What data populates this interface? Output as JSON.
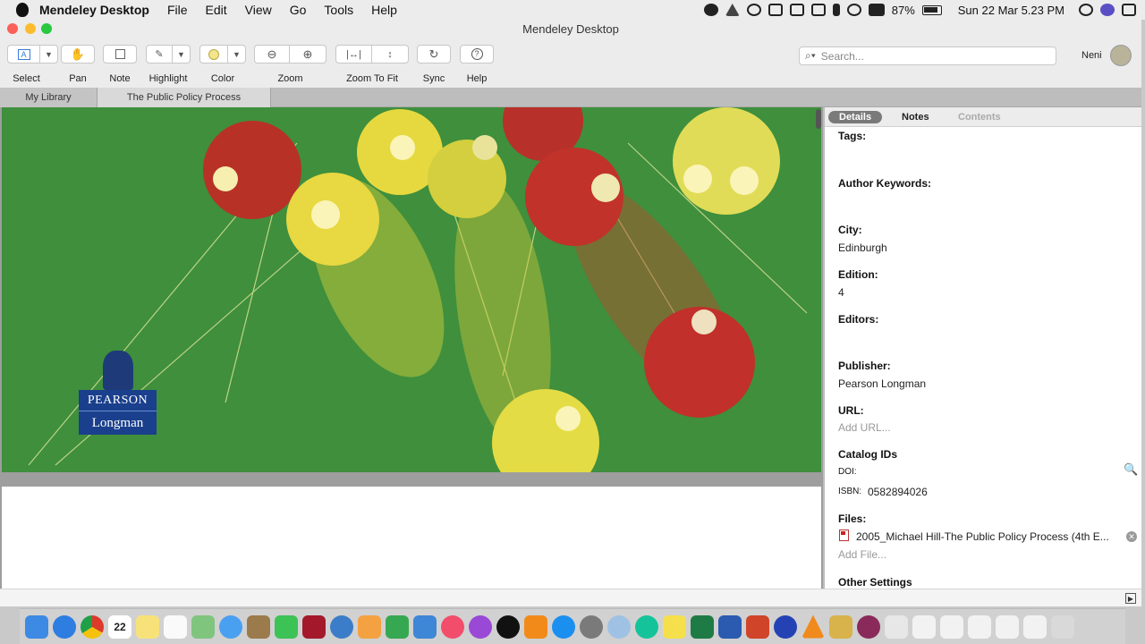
{
  "menubar": {
    "app_name": "Mendeley Desktop",
    "items": [
      "File",
      "Edit",
      "View",
      "Go",
      "Tools",
      "Help"
    ],
    "battery": "87%",
    "clock": "Sun 22 Mar  5.23 PM"
  },
  "window": {
    "title": "Mendeley Desktop"
  },
  "toolbar": {
    "select": "Select",
    "pan": "Pan",
    "note": "Note",
    "highlight": "Highlight",
    "color": "Color",
    "zoom": "Zoom",
    "zoom_to_fit": "Zoom To Fit",
    "sync": "Sync",
    "help": "Help",
    "search_placeholder": "Search...",
    "user": "Neni",
    "highlight_color": "#f3e58a"
  },
  "tabs": {
    "library": "My Library",
    "document": "The Public Policy Process"
  },
  "cover": {
    "publisher_line1": "PEARSON",
    "publisher_line2": "Longman",
    "background_color": "#3f8f3d"
  },
  "details": {
    "tabs": {
      "details": "Details",
      "notes": "Notes",
      "contents": "Contents"
    },
    "tags_label": "Tags:",
    "author_keywords_label": "Author Keywords:",
    "city_label": "City:",
    "city_value": "Edinburgh",
    "edition_label": "Edition:",
    "edition_value": "4",
    "editors_label": "Editors:",
    "publisher_label": "Publisher:",
    "publisher_value": "Pearson Longman",
    "url_label": "URL:",
    "url_placeholder": "Add URL...",
    "catalog_label": "Catalog IDs",
    "doi_label": "DOI:",
    "isbn_label": "ISBN:",
    "isbn_value": "0582894026",
    "files_label": "Files:",
    "file_name": "2005_Michael Hill-The Public Policy Process (4th E...",
    "add_file": "Add File...",
    "other_settings": "Other Settings"
  },
  "dock": {
    "calendar_day": "22"
  }
}
